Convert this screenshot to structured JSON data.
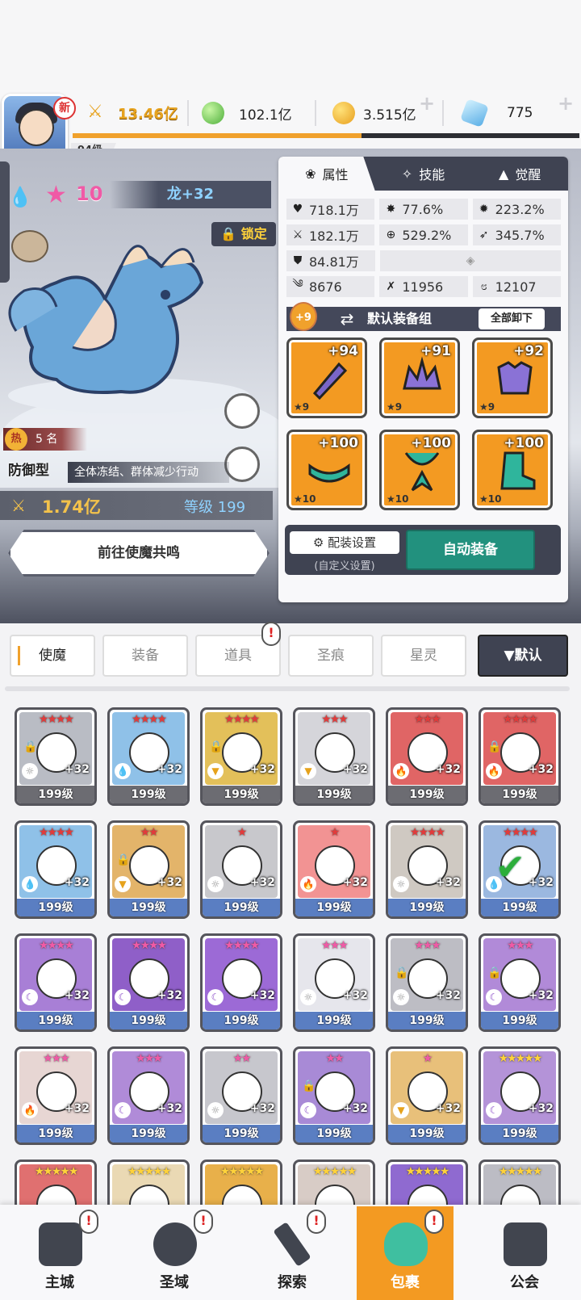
{
  "player": {
    "new_badge": "新",
    "level": "94级",
    "xp_fraction": 0.57
  },
  "currencies": [
    {
      "name": "power",
      "value": "13.46亿",
      "icon": "crossed-swords-icon"
    },
    {
      "name": "green-gem",
      "value": "102.1亿",
      "icon": "green-orb-icon"
    },
    {
      "name": "gold",
      "value": "3.515亿",
      "icon": "gold-coin-icon"
    },
    {
      "name": "crystal",
      "value": "775",
      "icon": "blue-crystal-icon"
    }
  ],
  "hero": {
    "star_count": "10",
    "name": "龙+32",
    "lock_label": "锁定",
    "hot_label": "热",
    "rank": "5 名",
    "type": "防御型",
    "skill_desc": "全体冻结、群体减少行动",
    "power": "1.74亿",
    "level": "等级 199",
    "resonate_button": "前往使魔共鸣"
  },
  "panel": {
    "tabs": [
      {
        "label": "属性",
        "icon": "swirl-icon"
      },
      {
        "label": "技能",
        "icon": "sparkle-icon"
      },
      {
        "label": "觉醒",
        "icon": "triangle-icon"
      }
    ],
    "stats": {
      "hp": "718.1万",
      "crit_rate": "77.6%",
      "crit_dmg": "223.2%",
      "atk": "182.1万",
      "accuracy": "529.2%",
      "speed_bonus": "345.7%",
      "def": "84.81万",
      "speed": "8676",
      "stat_a": "11956",
      "stat_b": "12107"
    },
    "gear_plus": "+9",
    "gear_set_label": "默认装备组",
    "unequip_all": "全部卸下",
    "gear": [
      {
        "enh": "+94",
        "stars": "★9",
        "icon": "dagger-icon"
      },
      {
        "enh": "+91",
        "stars": "★9",
        "icon": "crown-helmet-icon"
      },
      {
        "enh": "+92",
        "stars": "★9",
        "icon": "armor-icon"
      },
      {
        "enh": "+100",
        "stars": "★10",
        "icon": "belt-icon"
      },
      {
        "enh": "+100",
        "stars": "★10",
        "icon": "necklace-icon"
      },
      {
        "enh": "+100",
        "stars": "★10",
        "icon": "boots-icon"
      }
    ],
    "outfit_settings": "配装设置",
    "outfit_sub": "(自定义设置)",
    "auto_equip": "自动装备"
  },
  "inventory": {
    "tabs": [
      "使魔",
      "装备",
      "道具",
      "圣痕",
      "星灵"
    ],
    "sort_label": "▼默认",
    "items": [
      {
        "stars": "★★★★",
        "plus": "+32",
        "level": "199级",
        "color": "#b9bcc4",
        "elem": "☼",
        "lock": true
      },
      {
        "stars": "★★★★",
        "plus": "+32",
        "level": "199级",
        "color": "#8fc1e8",
        "elem": "💧",
        "lock": false
      },
      {
        "stars": "★★★★",
        "plus": "+32",
        "level": "199级",
        "color": "#e3c05a",
        "elem": "▼",
        "lock": true
      },
      {
        "stars": "★★★",
        "plus": "+32",
        "level": "199级",
        "color": "#d5d5da",
        "elem": "▼",
        "lock": false
      },
      {
        "stars": "★★★",
        "plus": "+32",
        "level": "199级",
        "color": "#e06565",
        "elem": "🔥",
        "lock": false
      },
      {
        "stars": "★★★★",
        "plus": "+32",
        "level": "199级",
        "color": "#e06565",
        "elem": "🔥",
        "lock": true
      },
      {
        "stars": "★★★★",
        "plus": "+32",
        "level": "199级",
        "color": "#8fc1e8",
        "elem": "💧",
        "lock": false
      },
      {
        "stars": "★★",
        "plus": "+32",
        "level": "199级",
        "color": "#e3b46a",
        "elem": "▼",
        "lock": true
      },
      {
        "stars": "★",
        "plus": "+32",
        "level": "199级",
        "color": "#c8c8cc",
        "elem": "☼",
        "lock": false
      },
      {
        "stars": "★",
        "plus": "+32",
        "level": "199级",
        "color": "#f29393",
        "elem": "🔥",
        "lock": false
      },
      {
        "stars": "★★★★",
        "plus": "+32",
        "level": "199级",
        "color": "#cfc9c2",
        "elem": "☼",
        "lock": false
      },
      {
        "stars": "★★★★",
        "plus": "+32",
        "level": "199级",
        "color": "#9bb8e0",
        "elem": "💧",
        "lock": false,
        "check": true
      },
      {
        "stars": "★★★★",
        "plus": "+32",
        "level": "199级",
        "color": "#a87fd6",
        "elem": "☾",
        "lock": false
      },
      {
        "stars": "★★★★",
        "plus": "+32",
        "level": "199级",
        "color": "#8f5fc8",
        "elem": "☾",
        "lock": false
      },
      {
        "stars": "★★★★",
        "plus": "+32",
        "level": "199级",
        "color": "#9c6ad6",
        "elem": "☾",
        "lock": false
      },
      {
        "stars": "★★★",
        "plus": "+32",
        "level": "199级",
        "color": "#e6e6ec",
        "elem": "☼",
        "lock": false
      },
      {
        "stars": "★★★",
        "plus": "+32",
        "level": "199级",
        "color": "#bdbdc4",
        "elem": "☼",
        "lock": true
      },
      {
        "stars": "★★★",
        "plus": "+32",
        "level": "199级",
        "color": "#b18ad8",
        "elem": "☾",
        "lock": true
      },
      {
        "stars": "★★★",
        "plus": "+32",
        "level": "199级",
        "color": "#e7d6d3",
        "elem": "🔥",
        "lock": false
      },
      {
        "stars": "★★★",
        "plus": "+32",
        "level": "199级",
        "color": "#b08bd8",
        "elem": "☾",
        "lock": false
      },
      {
        "stars": "★★",
        "plus": "+32",
        "level": "199级",
        "color": "#c7c7cd",
        "elem": "☼",
        "lock": false
      },
      {
        "stars": "★★",
        "plus": "+32",
        "level": "199级",
        "color": "#a88ad6",
        "elem": "☾",
        "lock": true
      },
      {
        "stars": "★",
        "plus": "+32",
        "level": "199级",
        "color": "#e8c07a",
        "elem": "▼",
        "lock": false
      },
      {
        "stars": "★★★★★",
        "plus": "+32",
        "level": "199级",
        "color": "#b493d8",
        "elem": "☾",
        "lock": false
      },
      {
        "stars": "★★★★★",
        "plus": "",
        "level": "",
        "color": "#e07070",
        "elem": "",
        "lock": false
      },
      {
        "stars": "★★★★★",
        "plus": "",
        "level": "",
        "color": "#ead9b4",
        "elem": "",
        "lock": false
      },
      {
        "stars": "★★★★★",
        "plus": "",
        "level": "",
        "color": "#e8b04a",
        "elem": "",
        "lock": false
      },
      {
        "stars": "★★★★★",
        "plus": "",
        "level": "",
        "color": "#d8ccc6",
        "elem": "",
        "lock": false
      },
      {
        "stars": "★★★★★",
        "plus": "",
        "level": "",
        "color": "#8f6ad0",
        "elem": "",
        "lock": false
      },
      {
        "stars": "★★★★★",
        "plus": "",
        "level": "",
        "color": "#bcbcc4",
        "elem": "",
        "lock": false
      }
    ]
  },
  "bottom_nav": [
    {
      "label": "主城",
      "icon": "castle-icon"
    },
    {
      "label": "圣域",
      "icon": "vortex-icon"
    },
    {
      "label": "探索",
      "icon": "sword-icon"
    },
    {
      "label": "包裹",
      "icon": "bag-icon"
    },
    {
      "label": "公会",
      "icon": "guild-icon"
    }
  ],
  "alert_mark": "!"
}
